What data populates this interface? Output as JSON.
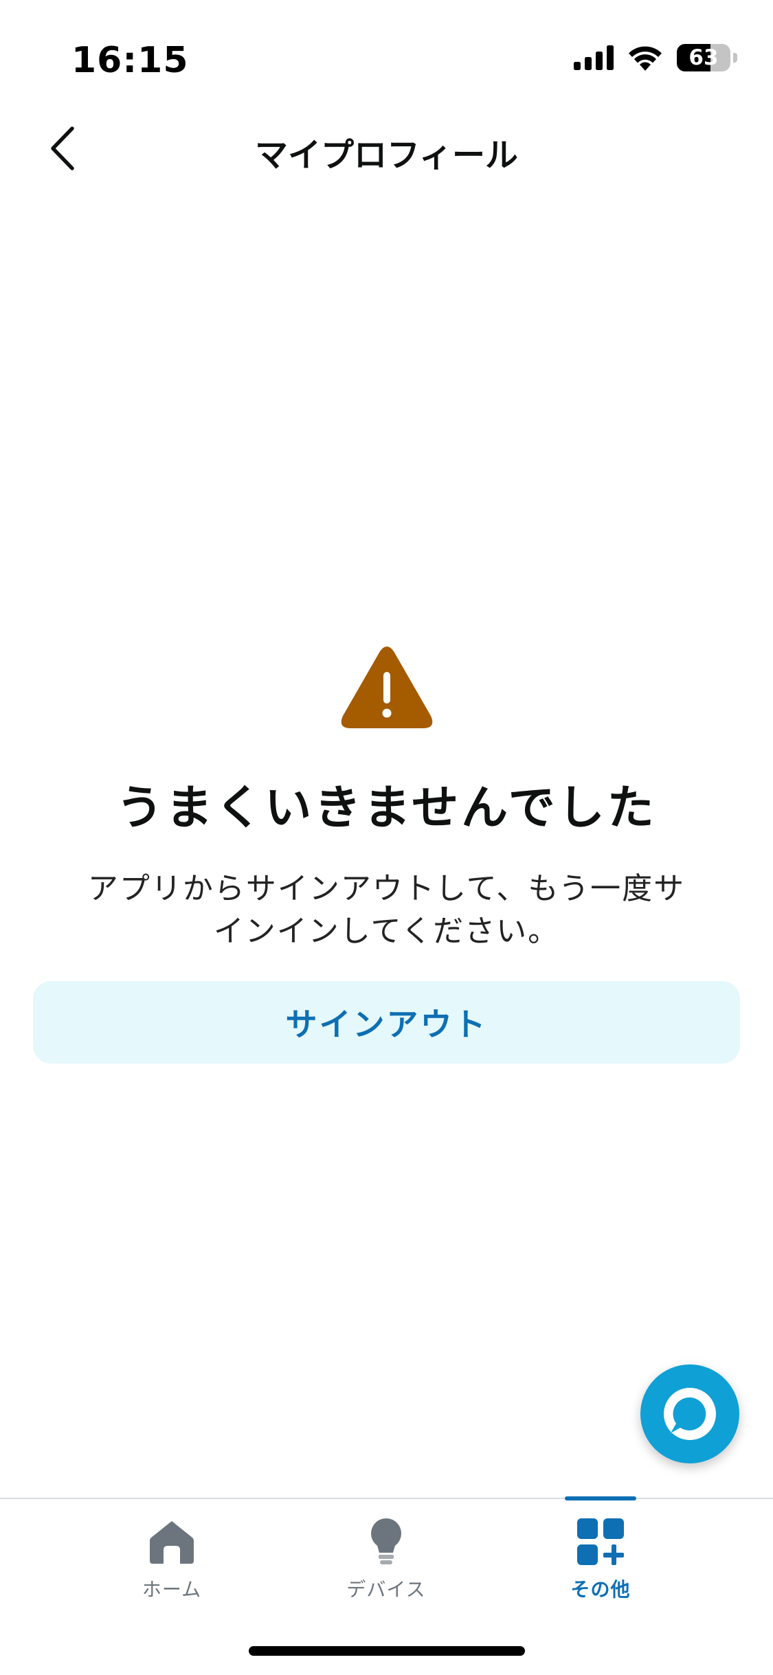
{
  "status_bar": {
    "time": "16:15",
    "battery_percent": 63,
    "battery_label": "63",
    "icons": [
      "cellular-signal-icon",
      "wifi-icon",
      "battery-icon"
    ]
  },
  "header": {
    "title": "マイプロフィール",
    "back_icon": "chevron-left-icon"
  },
  "error": {
    "icon": "warning-icon",
    "icon_color": "#a55b00",
    "title": "うまくいきませんでした",
    "message_line1": "アプリからサインアウトして、もう一度サ",
    "message_line2": "インインしてください。"
  },
  "actions": {
    "signout_label": "サインアウト",
    "signout_bg": "#e5f8fb",
    "signout_color": "#0e6fb3"
  },
  "fab": {
    "icon": "alexa-icon",
    "color": "#0fa0d6"
  },
  "tabs": [
    {
      "label": "ホーム",
      "icon": "home-icon",
      "active": false
    },
    {
      "label": "デバイス",
      "icon": "lightbulb-icon",
      "active": false
    },
    {
      "label": "その他",
      "icon": "more-grid-icon",
      "active": true
    }
  ],
  "colors": {
    "accent": "#0e6fb3",
    "inactive_tab": "#6c757d"
  }
}
